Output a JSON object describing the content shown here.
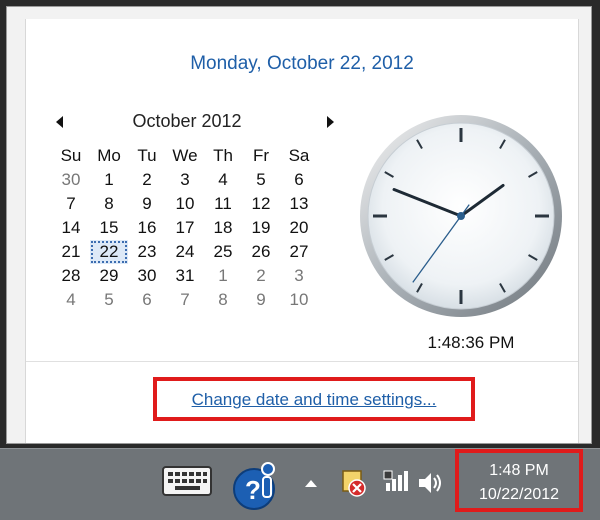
{
  "popup": {
    "long_date": "Monday, October 22, 2012",
    "month_label": "October 2012",
    "weekdays": [
      "Su",
      "Mo",
      "Tu",
      "We",
      "Th",
      "Fr",
      "Sa"
    ],
    "weeks": [
      [
        {
          "d": "30",
          "o": true
        },
        {
          "d": "1"
        },
        {
          "d": "2"
        },
        {
          "d": "3"
        },
        {
          "d": "4"
        },
        {
          "d": "5"
        },
        {
          "d": "6"
        }
      ],
      [
        {
          "d": "7"
        },
        {
          "d": "8"
        },
        {
          "d": "9"
        },
        {
          "d": "10"
        },
        {
          "d": "11"
        },
        {
          "d": "12"
        },
        {
          "d": "13"
        }
      ],
      [
        {
          "d": "14"
        },
        {
          "d": "15"
        },
        {
          "d": "16"
        },
        {
          "d": "17"
        },
        {
          "d": "18"
        },
        {
          "d": "19"
        },
        {
          "d": "20"
        }
      ],
      [
        {
          "d": "21"
        },
        {
          "d": "22",
          "today": true
        },
        {
          "d": "23"
        },
        {
          "d": "24"
        },
        {
          "d": "25"
        },
        {
          "d": "26"
        },
        {
          "d": "27"
        }
      ],
      [
        {
          "d": "28"
        },
        {
          "d": "29"
        },
        {
          "d": "30"
        },
        {
          "d": "31"
        },
        {
          "d": "1",
          "o": true
        },
        {
          "d": "2",
          "o": true
        },
        {
          "d": "3",
          "o": true
        }
      ],
      [
        {
          "d": "4",
          "o": true
        },
        {
          "d": "5",
          "o": true
        },
        {
          "d": "6",
          "o": true
        },
        {
          "d": "7",
          "o": true
        },
        {
          "d": "8",
          "o": true
        },
        {
          "d": "9",
          "o": true
        },
        {
          "d": "10",
          "o": true
        }
      ]
    ],
    "clock": {
      "hour": 1,
      "minute": 48,
      "second": 36
    },
    "time_text": "1:48:36 PM",
    "settings_link": "Change date and time settings..."
  },
  "taskbar": {
    "icons": [
      "keyboard-icon",
      "app-logo-icon",
      "show-hidden-icons-chevron",
      "action-center-flag-icon",
      "network-signal-icon",
      "volume-icon"
    ],
    "time": "1:48 PM",
    "date": "10/22/2012"
  },
  "colors": {
    "link": "#1f5fa8",
    "highlight_border": "#e01b1b",
    "taskbar": "#6f7478"
  }
}
